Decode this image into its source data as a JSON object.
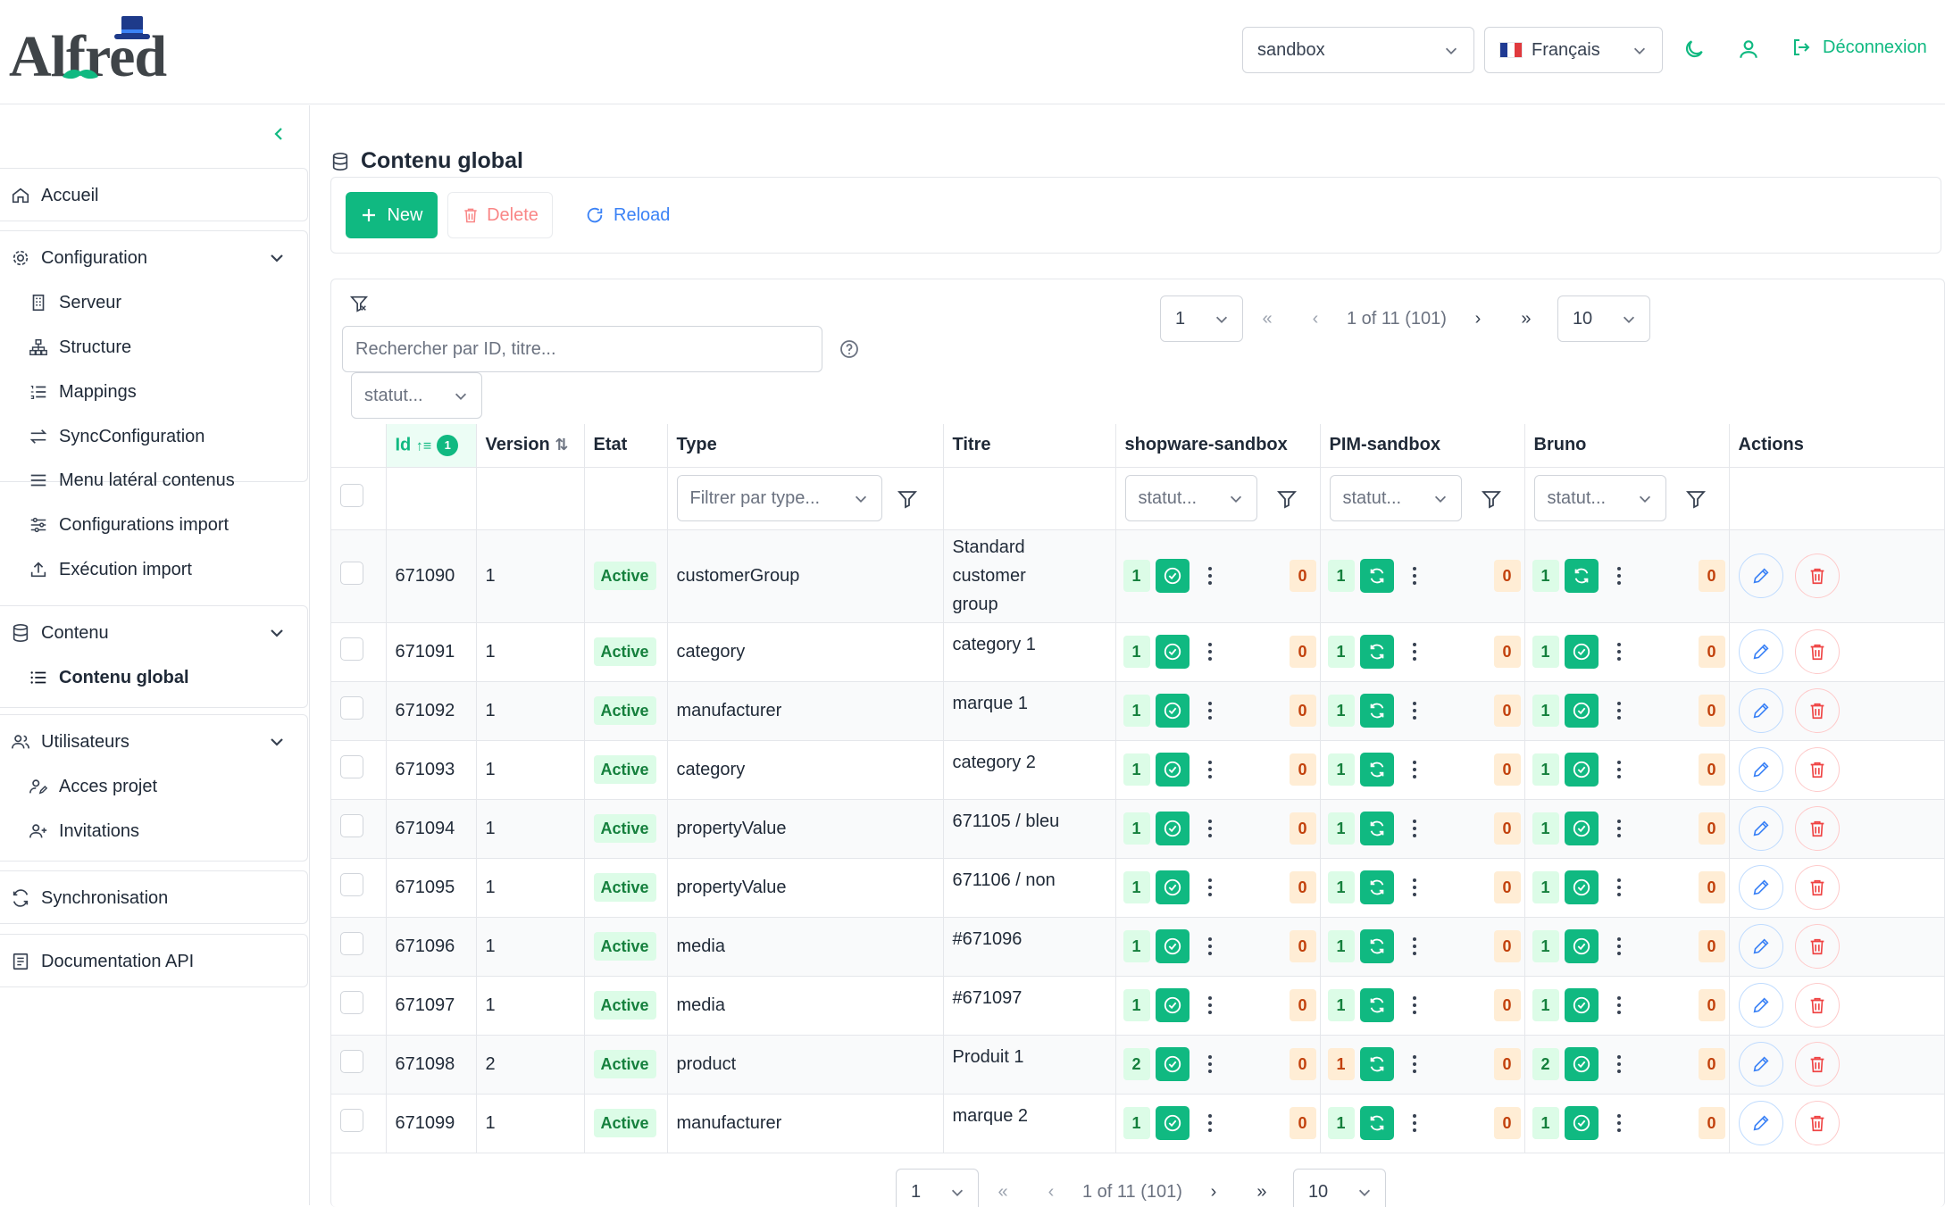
{
  "header": {
    "logo_text": "Alfred",
    "env_select": "sandbox",
    "lang_select": "Français",
    "logout": "Déconnexion"
  },
  "sidebar": {
    "items": [
      {
        "label": "Accueil"
      },
      {
        "label": "Configuration",
        "children": [
          "Serveur",
          "Structure",
          "Mappings",
          "SyncConfiguration",
          "Menu latéral contenus",
          "Configurations import",
          "Exécution import"
        ]
      },
      {
        "label": "Contenu",
        "children": [
          "Contenu global"
        ]
      },
      {
        "label": "Utilisateurs",
        "children": [
          "Acces projet",
          "Invitations"
        ]
      },
      {
        "label": "Synchronisation"
      },
      {
        "label": "Documentation API"
      }
    ]
  },
  "page": {
    "title": "Contenu global",
    "toolbar": {
      "new": "New",
      "delete": "Delete",
      "reload": "Reload"
    },
    "search_placeholder": "Rechercher par ID, titre...",
    "statut_placeholder": "statut...",
    "type_placeholder": "Filtrer par type...",
    "pager": {
      "page": "1",
      "summary": "1 of 11 (101)",
      "rows": "10"
    }
  },
  "table": {
    "columns": [
      "Id",
      "Version",
      "Etat",
      "Type",
      "Titre",
      "shopware-sandbox",
      "PIM-sandbox",
      "Bruno",
      "Actions"
    ],
    "sort_badge": "1",
    "rows": [
      {
        "id": "671090",
        "version": "1",
        "etat": "Active",
        "type": "customerGroup",
        "titre": "Standard customer group",
        "shop": "1",
        "pim": "1",
        "bruno": "1",
        "shop_err": "0",
        "pim_err": "0",
        "bruno_err": "0"
      },
      {
        "id": "671091",
        "version": "1",
        "etat": "Active",
        "type": "category",
        "titre": "category 1",
        "shop": "1",
        "pim": "1",
        "bruno": "1",
        "shop_err": "0",
        "pim_err": "0",
        "bruno_err": "0"
      },
      {
        "id": "671092",
        "version": "1",
        "etat": "Active",
        "type": "manufacturer",
        "titre": "marque 1",
        "shop": "1",
        "pim": "1",
        "bruno": "1",
        "shop_err": "0",
        "pim_err": "0",
        "bruno_err": "0"
      },
      {
        "id": "671093",
        "version": "1",
        "etat": "Active",
        "type": "category",
        "titre": "category 2",
        "shop": "1",
        "pim": "1",
        "bruno": "1",
        "shop_err": "0",
        "pim_err": "0",
        "bruno_err": "0"
      },
      {
        "id": "671094",
        "version": "1",
        "etat": "Active",
        "type": "propertyValue",
        "titre": "671105 / bleu",
        "shop": "1",
        "pim": "1",
        "bruno": "1",
        "shop_err": "0",
        "pim_err": "0",
        "bruno_err": "0"
      },
      {
        "id": "671095",
        "version": "1",
        "etat": "Active",
        "type": "propertyValue",
        "titre": "671106 / non",
        "shop": "1",
        "pim": "1",
        "bruno": "1",
        "shop_err": "0",
        "pim_err": "0",
        "bruno_err": "0"
      },
      {
        "id": "671096",
        "version": "1",
        "etat": "Active",
        "type": "media",
        "titre": "#671096",
        "shop": "1",
        "pim": "1",
        "bruno": "1",
        "shop_err": "0",
        "pim_err": "0",
        "bruno_err": "0"
      },
      {
        "id": "671097",
        "version": "1",
        "etat": "Active",
        "type": "media",
        "titre": "#671097",
        "shop": "1",
        "pim": "1",
        "bruno": "1",
        "shop_err": "0",
        "pim_err": "0",
        "bruno_err": "0"
      },
      {
        "id": "671098",
        "version": "2",
        "etat": "Active",
        "type": "product",
        "titre": "Produit 1",
        "shop": "2",
        "pim": "1",
        "bruno": "2",
        "shop_err": "0",
        "pim_err": "0",
        "bruno_err": "0",
        "pim_warn": true
      },
      {
        "id": "671099",
        "version": "1",
        "etat": "Active",
        "type": "manufacturer",
        "titre": "marque 2",
        "shop": "1",
        "pim": "1",
        "bruno": "1",
        "shop_err": "0",
        "pim_err": "0",
        "bruno_err": "0"
      }
    ]
  },
  "colors": {
    "accent": "#10b981",
    "danger": "#ef4444",
    "info": "#3b82f6",
    "warn": "#c2410c"
  }
}
